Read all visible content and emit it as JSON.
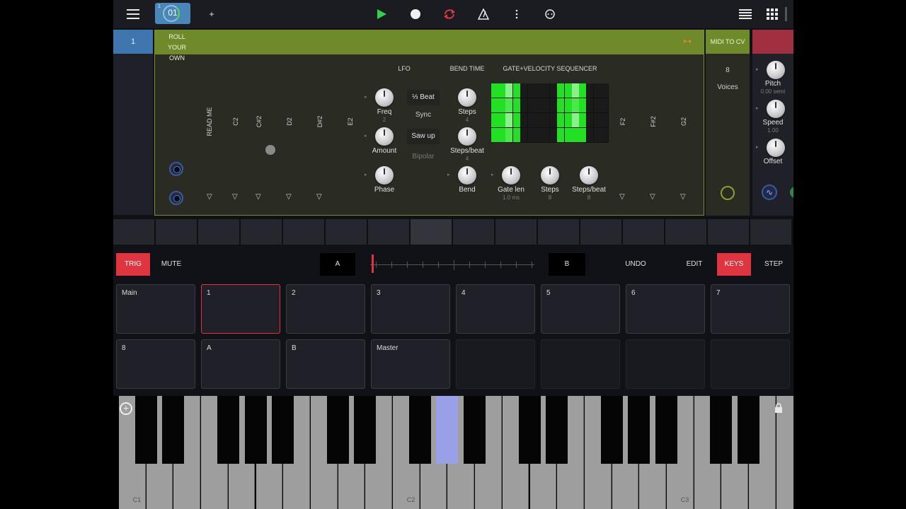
{
  "topbar": {
    "pattern_number": "01",
    "pattern_sub": "1",
    "add_label": "+"
  },
  "track": {
    "number": "1"
  },
  "device": {
    "name_line1": "ROLL YOUR",
    "name_line2": "OWN",
    "note_labels": [
      "READ ME",
      "C2",
      "C#2",
      "D2",
      "D#2",
      "E2",
      "F2",
      "F#2",
      "G2"
    ],
    "lfo_label": "LFO",
    "bend_time_label": "BEND TIME",
    "seq_label": "GATE+VELOCITY SEQUENCER",
    "beat_button": "⅓ Beat",
    "sync_label": "Sync",
    "saw_button": "Saw up",
    "bipolar_label": "Bipolar",
    "knobs": {
      "freq": {
        "label": "Freq",
        "value": "2"
      },
      "amount": {
        "label": "Amount",
        "value": ""
      },
      "phase": {
        "label": "Phase",
        "value": ""
      },
      "steps1": {
        "label": "Steps",
        "value": "4"
      },
      "stepsbeat1": {
        "label": "Steps/beat",
        "value": "4"
      },
      "bend": {
        "label": "Bend",
        "value": ""
      },
      "gatelen": {
        "label": "Gate len",
        "value": "1.0 ms"
      },
      "steps2": {
        "label": "Steps",
        "value": "8"
      },
      "stepsbeat2": {
        "label": "Steps/beat",
        "value": "8"
      }
    }
  },
  "midicv": {
    "title": "MIDI TO CV",
    "voices_value": "8",
    "voices_label": "Voices"
  },
  "third": {
    "knobs": [
      {
        "label": "Pitch",
        "value": "0.00 semi"
      },
      {
        "label": "Speed",
        "value": "1.00"
      },
      {
        "label": "Offset",
        "value": ""
      }
    ]
  },
  "controls": {
    "trig": "TRIG",
    "mute": "MUTE",
    "a": "A",
    "b": "B",
    "undo": "UNDO",
    "edit": "EDIT",
    "keys": "KEYS",
    "step": "STEP"
  },
  "pads": {
    "row1": [
      "Main",
      "1",
      "2",
      "3",
      "4",
      "5",
      "6",
      "7"
    ],
    "row2": [
      "8",
      "A",
      "B",
      "Master",
      "",
      "",
      "",
      ""
    ]
  },
  "keyboard": {
    "labels": [
      "C1",
      "C2",
      "C3"
    ]
  },
  "colors": {
    "accent_red": "#e03540",
    "track_blue": "#3f76b0",
    "device_green": "#6e8a2a",
    "play_green": "#2fd04a",
    "seq_green": "#22e022"
  }
}
